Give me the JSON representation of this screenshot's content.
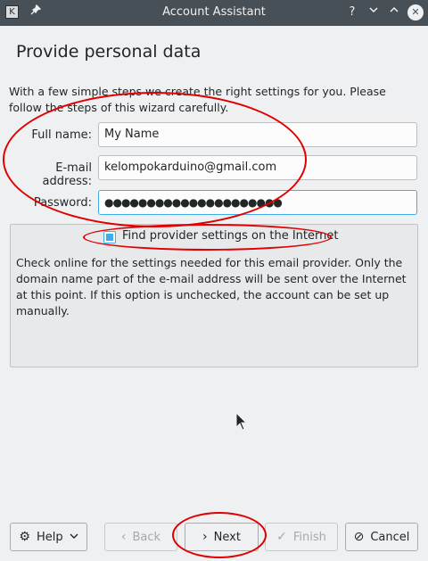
{
  "window": {
    "title": "Account Assistant",
    "app_icon": "kmail-icon",
    "controls": [
      "pin-icon",
      "help-icon",
      "minimize-icon",
      "maximize-icon",
      "close-icon"
    ]
  },
  "page": {
    "heading": "Provide personal data",
    "intro": "With a few simple steps we create the right settings for you. Please follow the steps of this wizard carefully."
  },
  "form": {
    "fullname_label": "Full name:",
    "fullname_value": "My Name",
    "email_label": "E-mail address:",
    "email_value": "kelompokarduino@gmail.com",
    "password_label": "Password:",
    "password_value": "●●●●●●●●●●●●●●●●●●●●●"
  },
  "provider": {
    "checkbox_label": "Find provider settings on the Internet",
    "checked": true,
    "description": "Check online for the settings needed for this email provider. Only the domain name part of the e-mail address will be sent over the Internet at this point. If this option is unchecked, the account can be set up manually."
  },
  "buttons": {
    "help": "Help",
    "back": "Back",
    "next": "Next",
    "finish": "Finish",
    "cancel": "Cancel"
  },
  "icons": {
    "help": "⚙",
    "dropdown": "⌵",
    "back": "‹",
    "next": "›",
    "finish": "✓",
    "cancel": "⊘"
  },
  "colors": {
    "accent": "#3daee9",
    "annotation": "#e00000",
    "titlebar": "#475057"
  }
}
